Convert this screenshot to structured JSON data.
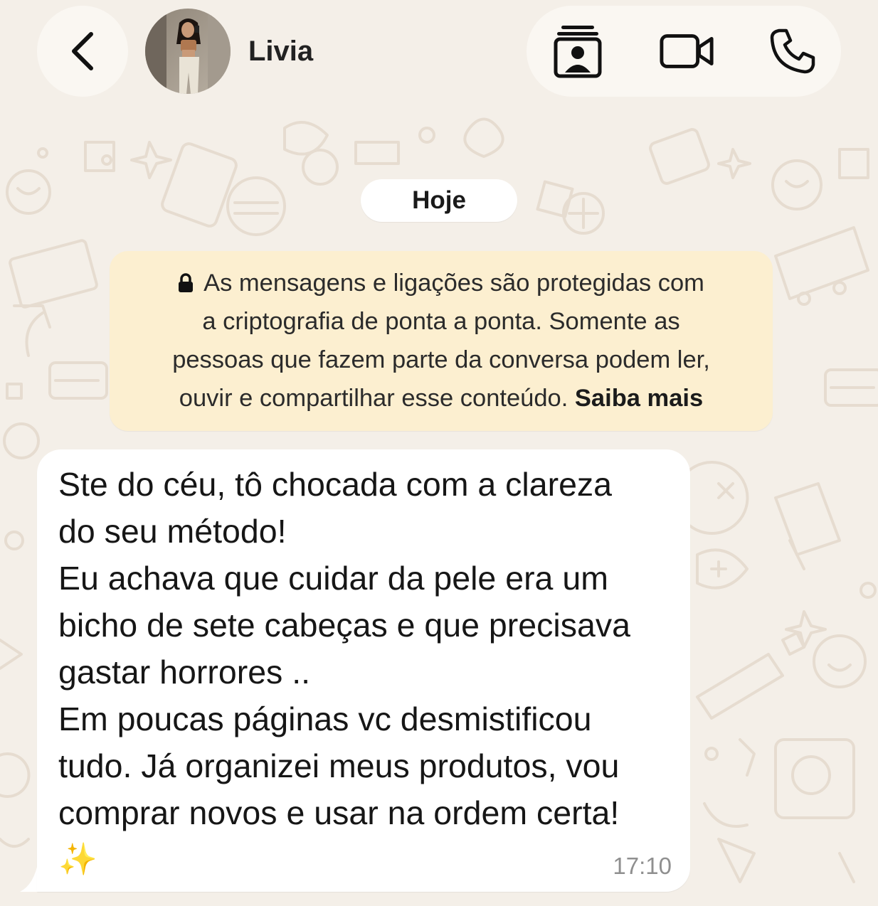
{
  "header": {
    "back_label": "Voltar",
    "contact_name": "Livia",
    "avatar_icon": "profile-photo"
  },
  "actions": {
    "contact_card_icon": "contact-card-icon",
    "video_call_icon": "video-camera-icon",
    "voice_call_icon": "phone-icon"
  },
  "chat": {
    "date_label": "Hoje",
    "encryption": {
      "lines": [
        "As mensagens e ligações são protegidas com",
        "a criptografia de ponta a ponta. Somente as",
        "pessoas que fazem parte da conversa podem ler,",
        "ouvir e compartilhar esse conteúdo."
      ],
      "learn_more": "Saiba mais"
    },
    "message": {
      "lines": [
        "Ste do céu, tô chocada com a clareza",
        "do seu método!",
        "Eu achava que cuidar da pele era um",
        "bicho de sete cabeças e que precisava",
        "gastar horrores ..",
        "Em poucas páginas vc desmistificou",
        "tudo. Já organizei meus produtos, vou",
        "comprar novos e usar na ordem certa!"
      ],
      "emoji": "✨",
      "time": "17:10"
    }
  },
  "colors": {
    "background": "#f4efe8",
    "header_pill": "#faf7f2",
    "encryption_notice": "#fcefd0",
    "bubble": "#ffffff",
    "timestamp": "#8f8f8f"
  }
}
